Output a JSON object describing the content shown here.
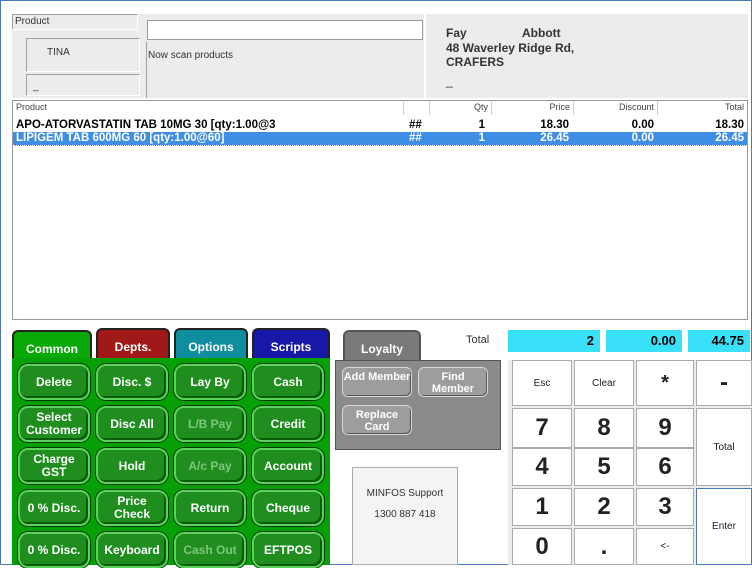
{
  "header": {
    "product_label": "Product",
    "user": "TINA",
    "blank_field_value": "_",
    "status_message": "Now scan products",
    "product_input_value": ""
  },
  "customer": {
    "first_name": "Fay",
    "last_name": "Abbott",
    "address": "48 Waverley Ridge Rd,",
    "suburb": "CRAFERS",
    "extra": "_"
  },
  "grid": {
    "columns": [
      "Product",
      "",
      "Qty",
      "Price",
      "Discount",
      "Total"
    ],
    "rows": [
      {
        "product": "APO-ATORVASTATIN TAB 10MG 30 [qty:1.00@3",
        "flag": "##",
        "qty": "1",
        "price": "18.30",
        "discount": "0.00",
        "total": "18.30"
      },
      {
        "product": "LIPIGEM TAB 600MG 60 [qty:1.00@60]",
        "flag": "##",
        "qty": "1",
        "price": "26.45",
        "discount": "0.00",
        "total": "26.45"
      }
    ]
  },
  "tabs": {
    "common": "Common",
    "depts": "Depts.",
    "options": "Options",
    "scripts": "Scripts",
    "loyalty": "Loyalty"
  },
  "totals": {
    "label": "Total",
    "count": "2",
    "discount": "0.00",
    "amount": "44.75"
  },
  "buttons": {
    "delete": "Delete",
    "disc_dollar": "Disc. $",
    "lay_by": "Lay By",
    "cash": "Cash",
    "select_customer": "Select Customer",
    "disc_all": "Disc All",
    "lb_pay": "L/B Pay",
    "credit": "Credit",
    "charge_gst": "Charge GST",
    "hold": "Hold",
    "ac_pay": "A/c Pay",
    "account": "Account",
    "pct_disc_1": "0 % Disc.",
    "price_check": "Price Check",
    "return": "Return",
    "cheque": "Cheque",
    "pct_disc_2": "0 % Disc.",
    "keyboard": "Keyboard",
    "cash_out": "Cash Out",
    "eftpos": "EFTPOS"
  },
  "loyalty_panel": {
    "add_member": "Add Member",
    "find_member": "Find Member",
    "replace_card": "Replace Card"
  },
  "support": {
    "name": "MINFOS Support",
    "phone": "1300 887 418"
  },
  "keypad": {
    "esc": "Esc",
    "clear": "Clear",
    "star": "*",
    "minus": "-",
    "k7": "7",
    "k8": "8",
    "k9": "9",
    "total": "Total",
    "k4": "4",
    "k5": "5",
    "k6": "6",
    "k1": "1",
    "k2": "2",
    "k3": "3",
    "enter": "Enter",
    "k0": "0",
    "dot": ".",
    "back": "<-"
  },
  "colors": {
    "common_tab": "#08a808",
    "depts_tab": "#a01818",
    "options_tab": "#0e8e9e",
    "scripts_tab": "#1818a8",
    "loyalty_tab": "#7a7a7a",
    "selected_row": "#3f8ee6",
    "totals_box": "#38e0f8"
  }
}
